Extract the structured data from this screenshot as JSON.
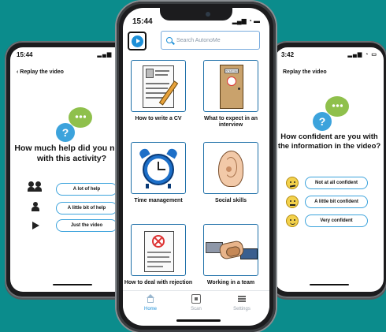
{
  "left_phone": {
    "time": "15:44",
    "back_label": "Replay the video",
    "question": "How much help did you need with this activity?",
    "options": [
      "A lot of help",
      "A little bit of help",
      "Just the video"
    ],
    "option_icons": [
      "two-people-icon",
      "person-icon",
      "play-arrow-icon"
    ]
  },
  "center_phone": {
    "time": "15:44",
    "search_placeholder": "Search AutonoMe",
    "cards": [
      {
        "label": "How to write a CV",
        "icon": "cv-document-icon"
      },
      {
        "label": "What to expect in an interview",
        "icon": "interview-door-icon"
      },
      {
        "label": "Time management",
        "icon": "alarm-clock-icon"
      },
      {
        "label": "Social skills",
        "icon": "ear-icon"
      },
      {
        "label": "How to deal with rejection",
        "icon": "rejection-letter-icon"
      },
      {
        "label": "Working in a team",
        "icon": "handshake-icon"
      }
    ],
    "tabs": [
      {
        "label": "Home",
        "active": true
      },
      {
        "label": "Scan",
        "active": false
      },
      {
        "label": "Settings",
        "active": false
      }
    ],
    "door_sign": "INTERVIEW",
    "accent": "#1d90d8"
  },
  "right_phone": {
    "time": "3:42",
    "back_label": "Replay the video",
    "question": "How confident are you with the information in the video?",
    "options": [
      "Not at all confident",
      "A little bit confident",
      "Very confident"
    ],
    "option_icons": [
      "unsure-face-icon",
      "neutral-face-icon",
      "happy-face-icon"
    ]
  }
}
